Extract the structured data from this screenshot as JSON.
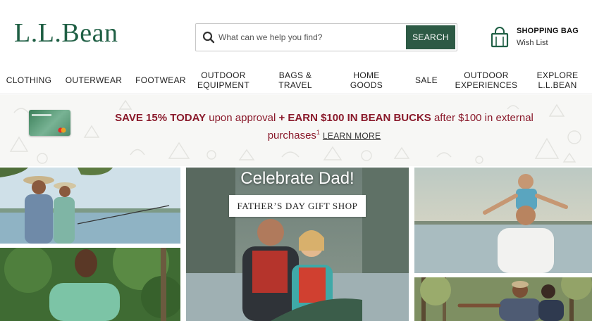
{
  "brand": {
    "logo_text": "L.L.Bean",
    "color": "#1f5f44"
  },
  "search": {
    "placeholder": "What can we help you find?",
    "button_label": "SEARCH",
    "icon": "search-icon"
  },
  "bag": {
    "title": "SHOPPING BAG",
    "subtitle": "Wish List",
    "icon": "shopping-bag-icon"
  },
  "nav": {
    "items": [
      {
        "label": "CLOTHING"
      },
      {
        "label": "OUTERWEAR"
      },
      {
        "label": "FOOTWEAR"
      },
      {
        "line1": "OUTDOOR",
        "line2": "EQUIPMENT"
      },
      {
        "line1": "BAGS &",
        "line2": "TRAVEL"
      },
      {
        "line1": "HOME",
        "line2": "GOODS"
      },
      {
        "label": "SALE"
      },
      {
        "line1": "OUTDOOR",
        "line2": "EXPERIENCES"
      },
      {
        "line1": "EXPLORE",
        "line2": "L.L.BEAN"
      }
    ]
  },
  "promo": {
    "highlight1": "SAVE 15% TODAY",
    "text1": " upon approval ",
    "highlight2": "+ EARN $100 IN BEAN BUCKS",
    "text2": " after $100 in external purchases",
    "footnote": "1",
    "link": "LEARN MORE",
    "accent_color": "#8a1a2b"
  },
  "hero": {
    "title": "Celebrate Dad!",
    "button_label": "FATHER’S DAY GIFT SHOP"
  },
  "colors": {
    "button_green": "#2d5a45"
  }
}
